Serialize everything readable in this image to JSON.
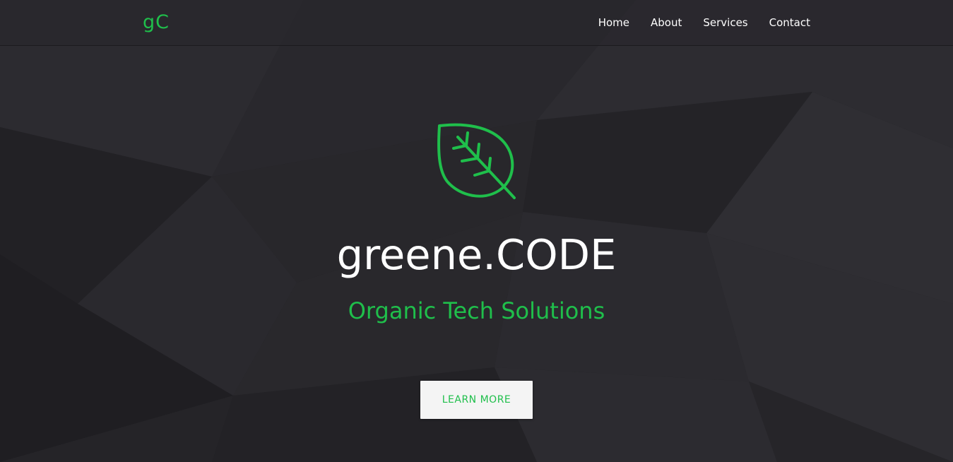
{
  "colors": {
    "accent": "#1fbf4b",
    "background": "#262529",
    "text": "#ffffff",
    "button_bg": "#f4f4f4"
  },
  "navbar": {
    "brand": "gC",
    "links": [
      "Home",
      "About",
      "Services",
      "Contact"
    ]
  },
  "hero": {
    "icon": "leaf-icon",
    "title": "greene.CODE",
    "subtitle": "Organic Tech Solutions",
    "cta_label": "LEARN MORE"
  }
}
